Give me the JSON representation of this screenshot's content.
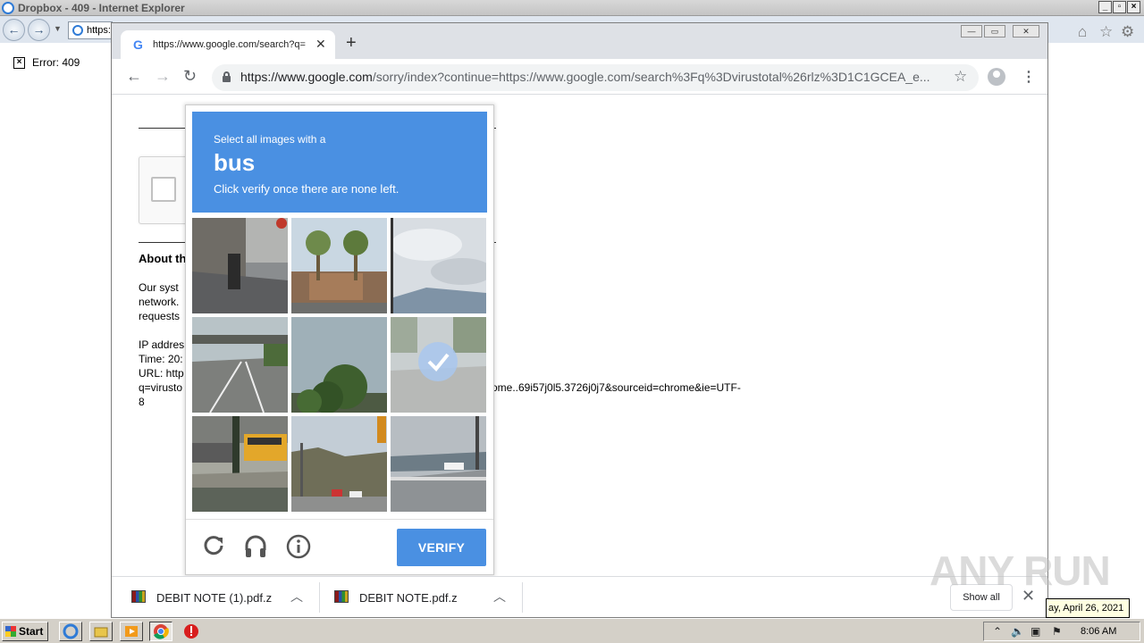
{
  "ie": {
    "title": "Dropbox - 409 - Internet Explorer",
    "address": "https:",
    "error_text": "Error: 409"
  },
  "chrome": {
    "tab_title": "https://www.google.com/search?q=",
    "tab_favicon": "G",
    "url_host": "https://www.google.com",
    "url_path": "/sorry/index?continue=https://www.google.com/search%3Fq%3Dvirustotal%26rlz%3D1C1GCEA_e..."
  },
  "page": {
    "about_heading": "About th",
    "lines_a": [
      "Our syst",
      "network.",
      "requests"
    ],
    "lines_b": [
      "IP addres",
      "Time: 20:",
      "URL: http",
      "q=virusto",
      "8"
    ],
    "url_tail": "ome..69i57j0l5.3726j0j7&sourceid=chrome&ie=UTF-"
  },
  "captcha": {
    "small": "Select all images with a",
    "target": "bus",
    "instruction": "Click verify once there are none left.",
    "verify_label": "VERIFY",
    "tiles": [
      {
        "name": "street-scooter",
        "selected": false
      },
      {
        "name": "palm-houses",
        "selected": false
      },
      {
        "name": "cloudy-sky-coast",
        "selected": false
      },
      {
        "name": "highway-bridge",
        "selected": false
      },
      {
        "name": "tree",
        "selected": false
      },
      {
        "name": "foggy-road",
        "selected": true
      },
      {
        "name": "school-bus",
        "selected": false
      },
      {
        "name": "traffic-light-trees",
        "selected": false
      },
      {
        "name": "bridge-road",
        "selected": false
      }
    ]
  },
  "downloads": {
    "items": [
      {
        "name": "DEBIT NOTE (1).pdf.z"
      },
      {
        "name": "DEBIT NOTE.pdf.z"
      }
    ],
    "show_all": "Show all"
  },
  "watermark": "ANY RUN",
  "tooltip_date": "ay, April 26, 2021",
  "taskbar": {
    "start_label": "Start",
    "clock": "8:06 AM"
  }
}
